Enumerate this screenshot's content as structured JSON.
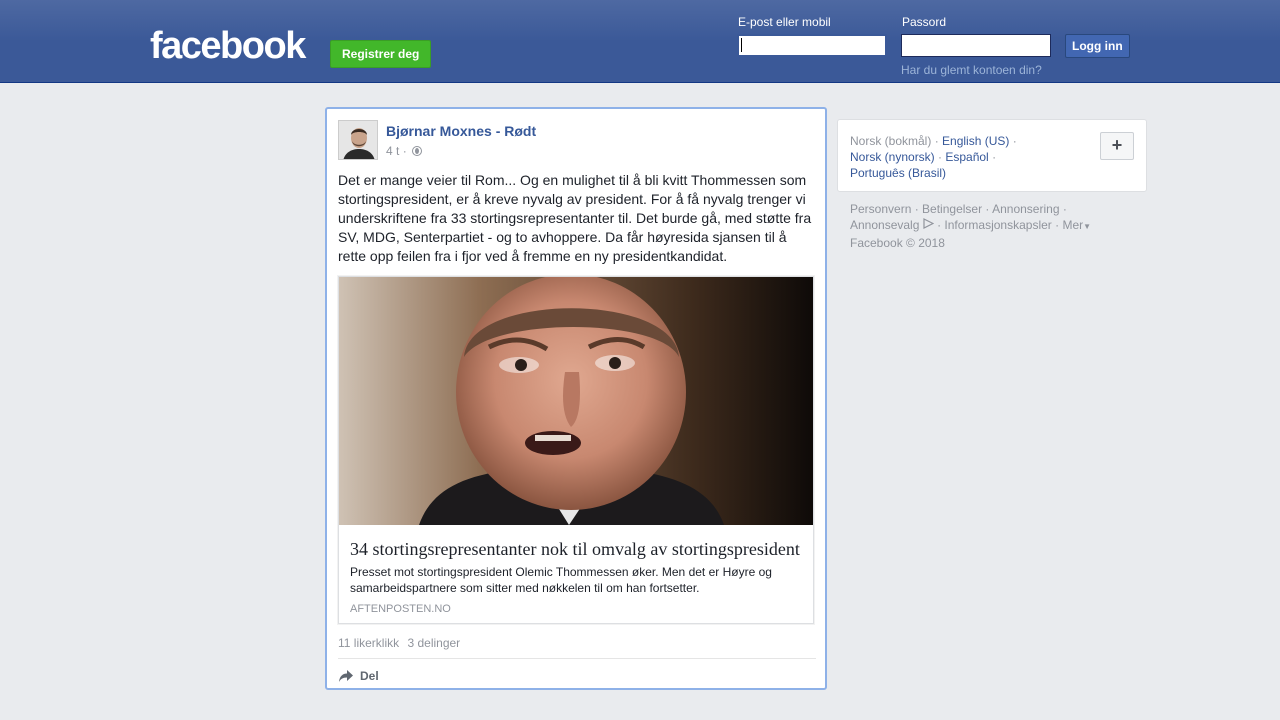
{
  "header": {
    "logo": "facebook",
    "register_label": "Registrer deg",
    "email_label": "E-post eller mobil",
    "email_value": "",
    "password_label": "Passord",
    "password_value": "",
    "login_label": "Logg inn",
    "forgot_label": "Har du glemt kontoen din?"
  },
  "post": {
    "author": "Bjørnar Moxnes - Rødt",
    "time": "4 t",
    "separator": "·",
    "text": "Det er mange veier til Rom... Og en mulighet til å bli kvitt Thommessen som stortingspresident, er å kreve nyvalg av president. For å få nyvalg trenger vi underskriftene fra 33 stortingsrepresentanter til. Det burde gå, med støtte fra SV, MDG, Senterpartiet - og to avhoppere. Da får høyresida sjansen til å rette opp feilen fra i fjor ved å fremme en ny presidentkandidat.",
    "link": {
      "title": "34 stortingsrepresentanter nok til omvalg av stortingspresident",
      "description": "Presset mot stortingspresident Olemic Thommessen øker. Men det er Høyre og samarbeidspartnere som sitter med nøkkelen til om han fortsetter.",
      "domain": "AFTENPOSTEN.NO"
    },
    "likes": "11 likerklikk",
    "shares": "3 delinger",
    "share_action": "Del"
  },
  "languages": {
    "current": "Norsk (bokmål)",
    "items": [
      "English (US)",
      "Norsk (nynorsk)",
      "Español",
      "Português (Brasil)"
    ],
    "more_label": "+"
  },
  "footer": {
    "links": [
      "Personvern",
      "Betingelser",
      "Annonsering",
      "Annonsevalg",
      "Informasjonskapsler",
      "Mer"
    ],
    "copyright": "Facebook © 2018"
  },
  "colors": {
    "brand": "#3b5998",
    "register": "#42b72a",
    "link": "#365899",
    "muted": "#90949c"
  }
}
